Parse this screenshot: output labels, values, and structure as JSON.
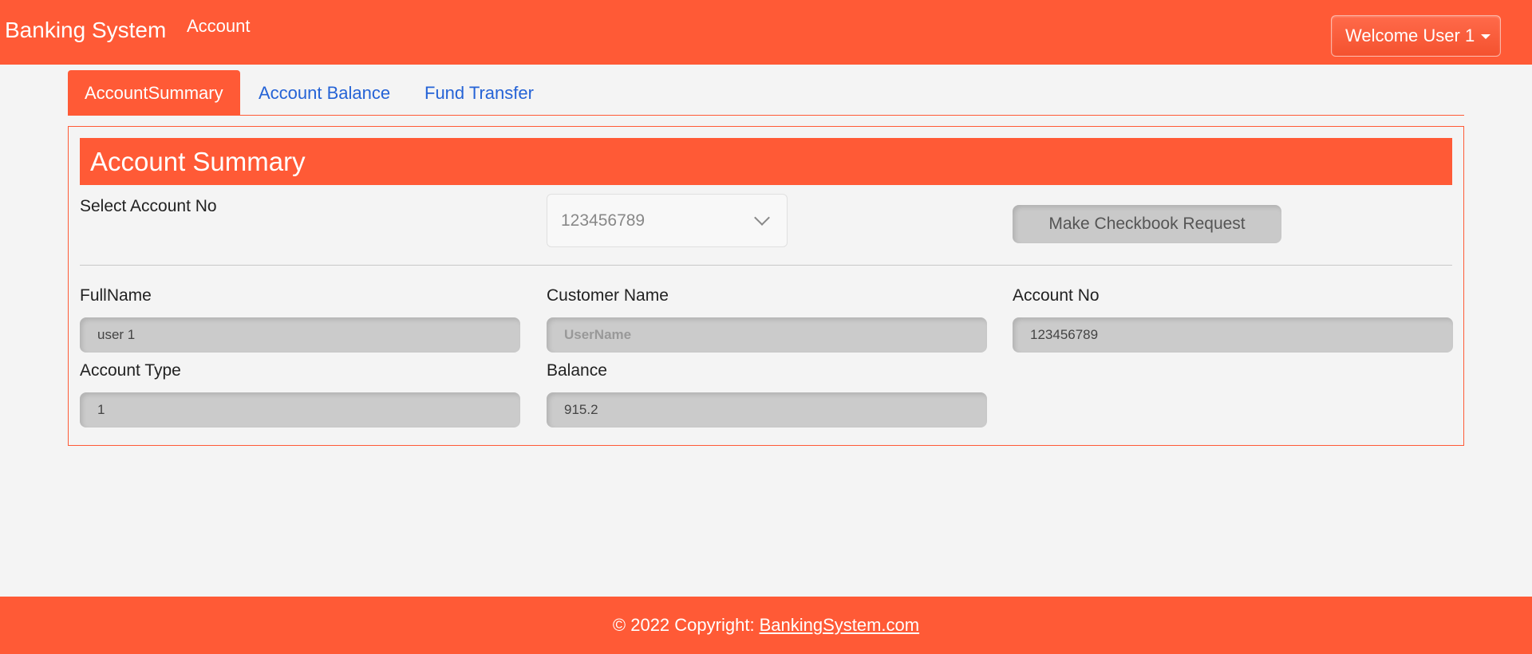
{
  "header": {
    "brand": "Banking System",
    "nav_link": "Account",
    "user_menu": "Welcome User 1"
  },
  "tabs": [
    {
      "label": "AccountSummary",
      "active": true
    },
    {
      "label": "Account Balance",
      "active": false
    },
    {
      "label": "Fund Transfer",
      "active": false
    }
  ],
  "summary": {
    "title": "Account Summary",
    "select_label": "Select Account No",
    "selected_account": "123456789",
    "checkbook_button": "Make Checkbook Request",
    "fields": {
      "fullname_label": "FullName",
      "fullname_value": "user 1",
      "customer_label": "Customer Name",
      "customer_placeholder": "UserName",
      "account_no_label": "Account No",
      "account_no_value": "123456789",
      "account_type_label": "Account Type",
      "account_type_value": "1",
      "balance_label": "Balance",
      "balance_value": "915.2"
    }
  },
  "footer": {
    "copyright": "© 2022 Copyright:",
    "link": "BankingSystem.com"
  },
  "colors": {
    "accent": "#ff5a36",
    "link": "#2563d6",
    "background": "#f4f4f4"
  }
}
